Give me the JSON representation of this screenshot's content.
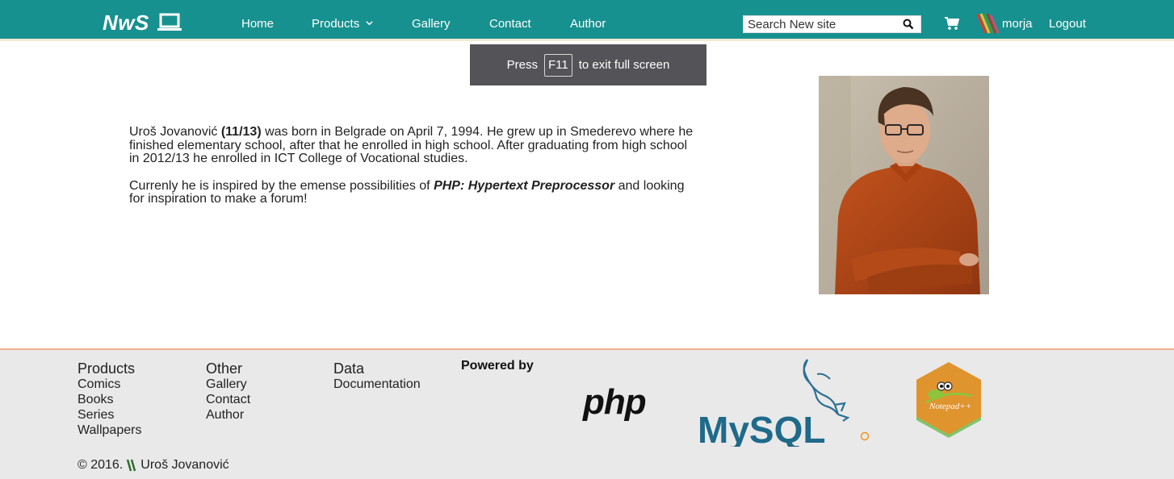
{
  "nav": {
    "brand": "NwS",
    "links": {
      "home": "Home",
      "products": "Products",
      "gallery": "Gallery",
      "contact": "Contact",
      "author": "Author"
    },
    "search_placeholder": "Search New site",
    "username": "morja",
    "logout": "Logout",
    "icons": [
      "laptop-icon",
      "chevron-down-icon",
      "search-icon",
      "cart-icon"
    ],
    "bar_color": "#17918f"
  },
  "fullscreen_notice": {
    "press": "Press",
    "key": "F11",
    "suffix": "to exit full screen"
  },
  "bio": {
    "p1_name": "Uroš Jovanović",
    "p1_year": "(11/13)",
    "p1_text": "was born in Belgrade on April 7, 1994. He grew up in Smederevo where he finished elementary school, after that he enrolled in high school. After graduating from high school in 2012/13 he enrolled in ICT College of Vocational studies.",
    "p2_text": "Currenly he is inspired by the emense possibilities of",
    "p2_emph": "PHP: Hypertext Preprocessor",
    "p2_tail": "and looking for inspiration to make a forum!"
  },
  "footer": {
    "columns": [
      {
        "heading": "Products",
        "links": [
          "Comics",
          "Books",
          "Series",
          "Wallpapers"
        ]
      },
      {
        "heading": "Other",
        "links": [
          "Gallery",
          "Contact",
          "Author"
        ]
      },
      {
        "heading": "Data",
        "links": [
          "Documentation"
        ]
      }
    ],
    "powered_by": "Powered by",
    "logo_php": "php",
    "logo_mysql": "MySQL",
    "logo_npp": "Notepad++",
    "copyright_year": "© 2016.",
    "copyright_name": "Uroš Jovanović",
    "accent_border": "#f0b08b"
  }
}
